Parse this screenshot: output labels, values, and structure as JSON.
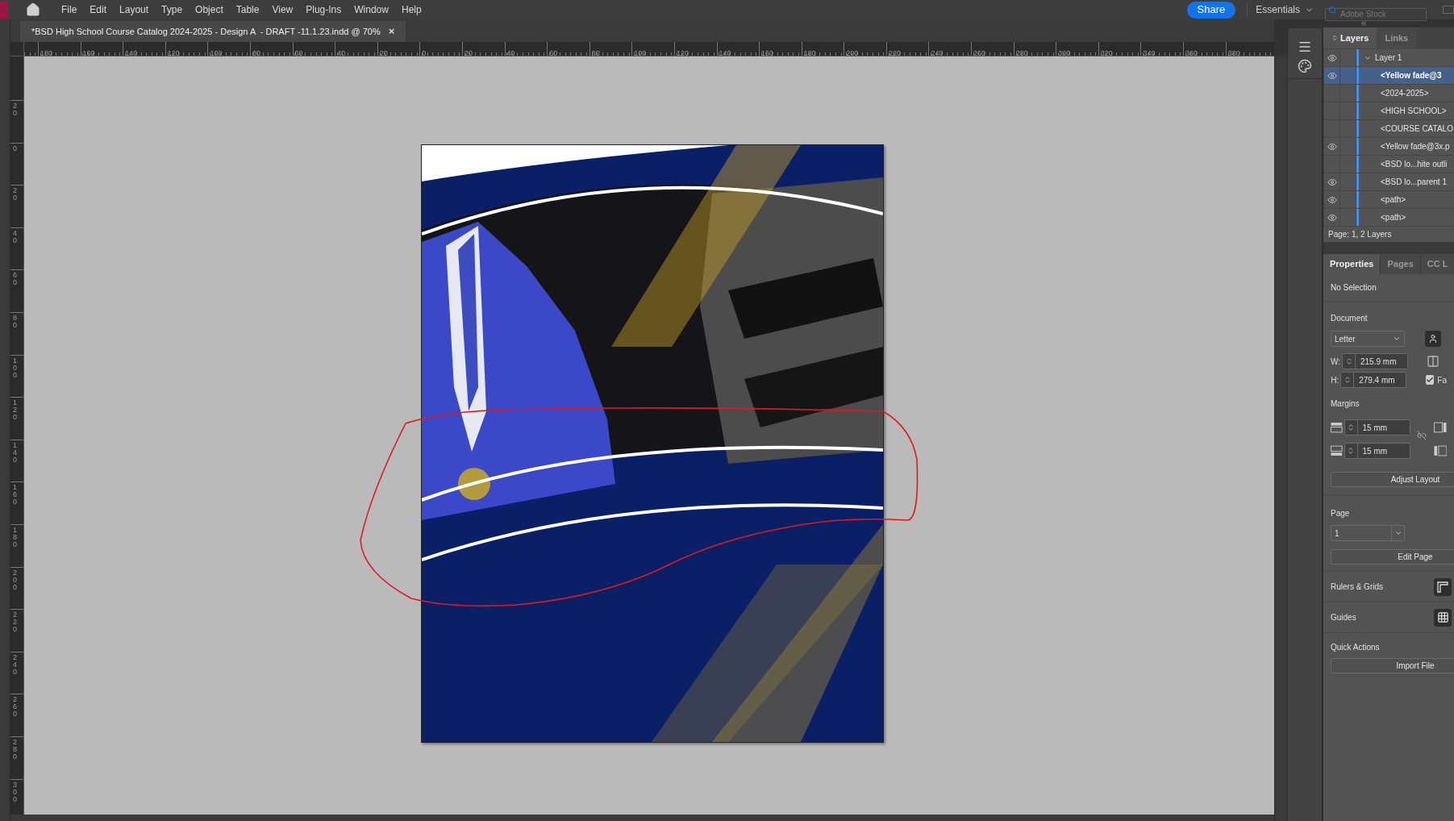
{
  "menu": [
    "File",
    "Edit",
    "Layout",
    "Type",
    "Object",
    "Table",
    "View",
    "Plug-Ins",
    "Window",
    "Help"
  ],
  "share": "Share",
  "workspace": "Essentials",
  "stock_search": {
    "placeholder": "Adobe Stock"
  },
  "document_tab": {
    "title": "*BSD High School Course Catalog 2024-2025 - Design A  - DRAFT -11.1.23.indd @ 70%",
    "close": "×"
  },
  "rulers": {
    "horizontal": [
      "180",
      "160",
      "140",
      "120",
      "100",
      "80",
      "60",
      "40",
      "20",
      "0",
      "20",
      "40",
      "60",
      "80",
      "100",
      "120",
      "140",
      "160",
      "180",
      "200",
      "220",
      "240",
      "260",
      "280",
      "300",
      "320",
      "340",
      "360",
      "380"
    ],
    "vertical": [
      "20",
      "0",
      "20",
      "40",
      "60",
      "80",
      "100",
      "120",
      "140",
      "160",
      "180",
      "200",
      "220",
      "240",
      "260",
      "280",
      "300"
    ]
  },
  "layers_panel": {
    "tabs": [
      {
        "label": "Layers",
        "selected": true
      },
      {
        "label": "Links",
        "selected": false
      }
    ],
    "layers": [
      {
        "name": "Layer 1",
        "visible": true,
        "selected": false,
        "expanded": true,
        "children": [
          {
            "name": "<Yellow fade@3",
            "visible": true,
            "selected": true
          },
          {
            "name": "<2024-2025>",
            "visible": false,
            "selected": false
          },
          {
            "name": "<HIGH SCHOOL>",
            "visible": false,
            "selected": false
          },
          {
            "name": "<COURSE CATALO",
            "visible": false,
            "selected": false
          },
          {
            "name": "<Yellow fade@3x.p",
            "visible": true,
            "selected": false
          },
          {
            "name": "<BSD lo...hite outli",
            "visible": false,
            "selected": false
          },
          {
            "name": "<BSD lo...parent 1",
            "visible": true,
            "selected": false
          },
          {
            "name": "<path>",
            "visible": true,
            "selected": false
          },
          {
            "name": "<path>",
            "visible": true,
            "selected": false
          }
        ]
      }
    ],
    "footer": "Page: 1, 2 Layers"
  },
  "properties_panel": {
    "tabs": [
      {
        "label": "Properties",
        "selected": true
      },
      {
        "label": "Pages",
        "selected": false
      },
      {
        "label": "CC L",
        "selected": false
      }
    ],
    "selection": "No Selection",
    "document": {
      "heading": "Document",
      "preset": "Letter",
      "width_label": "W:",
      "width": "215.9 mm",
      "height_label": "H:",
      "height": "279.4 mm",
      "facing_pages": {
        "label": "Fa",
        "checked": true
      }
    },
    "margins": {
      "heading": "Margins",
      "top": "15 mm",
      "bottom": "15 mm",
      "button": "Adjust Layout"
    },
    "page": {
      "heading": "Page",
      "value": "1",
      "button": "Edit Page"
    },
    "sections": [
      {
        "label": "Rulers & Grids",
        "kind": "rulers"
      },
      {
        "label": "Guides",
        "kind": "guides"
      }
    ],
    "quick_actions": {
      "heading": "Quick Actions",
      "button": "Import File"
    }
  }
}
